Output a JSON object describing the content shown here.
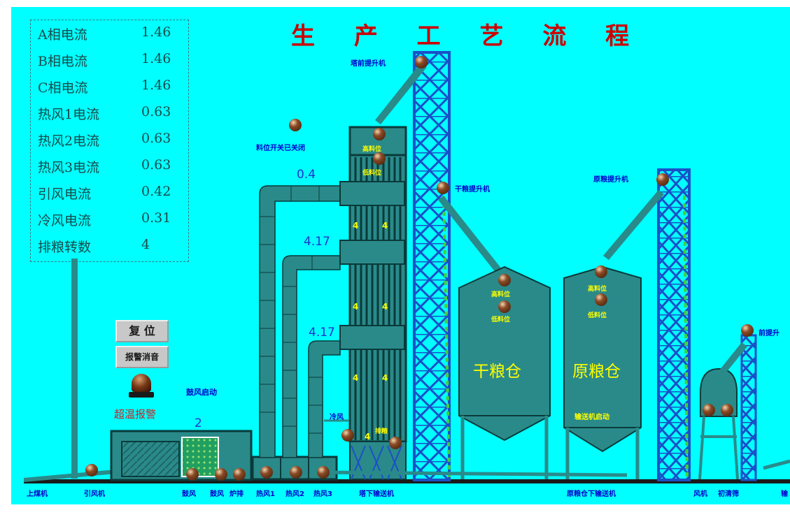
{
  "title": "生 产 工 艺 流 程",
  "readout": [
    {
      "name": "A相电流",
      "value": "1.46"
    },
    {
      "name": "B相电流",
      "value": "1.46"
    },
    {
      "name": "C相电流",
      "value": "1.46"
    },
    {
      "name": "热风1电流",
      "value": "0.63"
    },
    {
      "name": "热风2电流",
      "value": "0.63"
    },
    {
      "name": "热风3电流",
      "value": "0.63"
    },
    {
      "name": "引风电流",
      "value": "0.42"
    },
    {
      "name": "冷风电流",
      "value": "0.31"
    },
    {
      "name": "排粮转数",
      "value": "4"
    }
  ],
  "controls": {
    "reset_label": "复 位",
    "silence_label": "报警消音",
    "alarm_label": "超温报警"
  },
  "status": {
    "level_switch_text": "料位开关已关闭",
    "fan_start_text": "鼓风启动",
    "conveyor_start_text": "输送机启动"
  },
  "values": {
    "duct1": "0.4",
    "duct2": "4.17",
    "duct3": "4.17",
    "furnace": "2"
  },
  "tower_cell_value": "4",
  "equipment": {
    "tower_elevator": "塔前提升机",
    "dry_grain_elevator": "干粮提升机",
    "raw_grain_elevator": "原粮提升机",
    "front_elevator": "前提升",
    "tower_high_level": "高料位",
    "tower_low_level": "低料位",
    "dry_high_level": "高料位",
    "dry_low_level": "低料位",
    "raw_high_level": "高料位",
    "raw_low_level": "低料位",
    "cold_air": "冷风",
    "discharge": "排粮",
    "dry_silo": "干粮仓",
    "raw_silo": "原粮仓"
  },
  "bottom_labels": {
    "coal_feeder": "上煤机",
    "induced_fan": "引风机",
    "blower_left": "鼓风",
    "blower_mid": "鼓风",
    "blower_right": "炉排",
    "hot1": "热风1",
    "hot2": "热风2",
    "hot3": "热风3",
    "tower_conveyor": "塔下输送机",
    "silo_conveyor": "原粮仓下输送机",
    "fan": "风机",
    "cleaner": "初清筛",
    "right_edge": "输"
  },
  "colors": {
    "background": "#00ffff",
    "structure": "#2a8a8a",
    "title": "#cc0000",
    "value_text": "#2233cc",
    "label_text": "#0000cc",
    "silo_text": "#ffff00",
    "lattice": "#1a50c8"
  }
}
